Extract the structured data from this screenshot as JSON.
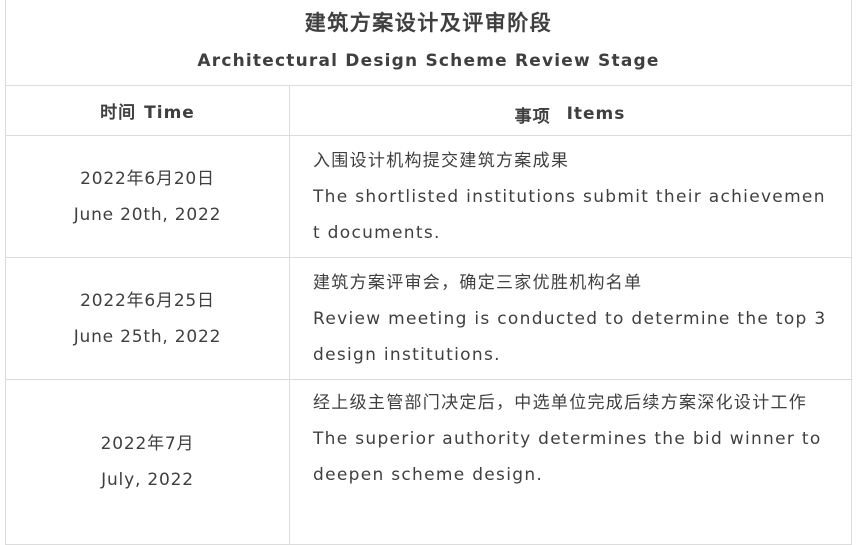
{
  "title": {
    "zh": "建筑方案设计及评审阶段",
    "en": "Architectural Design Scheme Review Stage"
  },
  "header": {
    "time_zh": "时间",
    "time_en": "Time",
    "items_zh": "事项",
    "items_en": "Items"
  },
  "rows": [
    {
      "date_zh": "2022年6月20日",
      "date_en": "June 20th, 2022",
      "item_zh": "入围设计机构提交建筑方案成果",
      "item_en": "The shortlisted institutions submit their achievement documents."
    },
    {
      "date_zh": "2022年6月25日",
      "date_en": "June 25th, 2022",
      "item_zh": "建筑方案评审会，确定三家优胜机构名单",
      "item_en": "Review meeting is conducted to determine the top 3 design institutions."
    },
    {
      "date_zh": "2022年7月",
      "date_en": "July, 2022",
      "item_zh": "经上级主管部门决定后，中选单位完成后续方案深化设计工作",
      "item_en": "The superior authority determines the bid winner to deepen scheme design."
    }
  ]
}
